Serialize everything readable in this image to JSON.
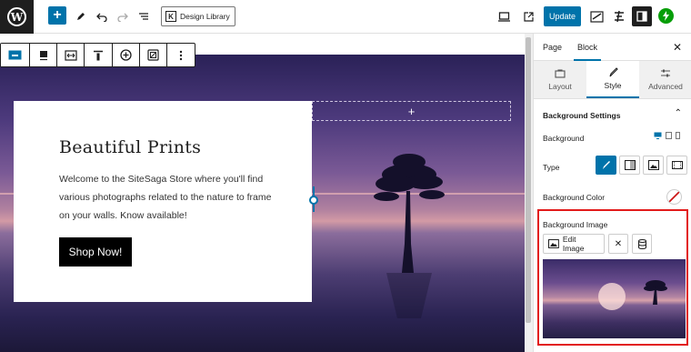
{
  "toolbar": {
    "design_library_label": "Design Library",
    "update_label": "Update",
    "design_library_icon": "K"
  },
  "hero": {
    "title": "Beautiful Prints",
    "text": "Welcome to the SiteSaga Store where you'll find various photographs related to the nature to frame on your walls. Know available!",
    "button_label": "Shop Now!",
    "add_slot": "+"
  },
  "sidebar": {
    "tabs": [
      {
        "label": "Page"
      },
      {
        "label": "Block"
      }
    ],
    "sub_tabs": [
      {
        "label": "Layout"
      },
      {
        "label": "Style"
      },
      {
        "label": "Advanced"
      }
    ],
    "section_title": "Background Settings",
    "background_label": "Background",
    "type_label": "Type",
    "color_label": "Background Color",
    "image_label": "Background Image",
    "edit_image_label": "Edit Image"
  },
  "colors": {
    "accent": "#0073aa",
    "highlight": "#e21b1b",
    "dark": "#1e1e1e"
  }
}
